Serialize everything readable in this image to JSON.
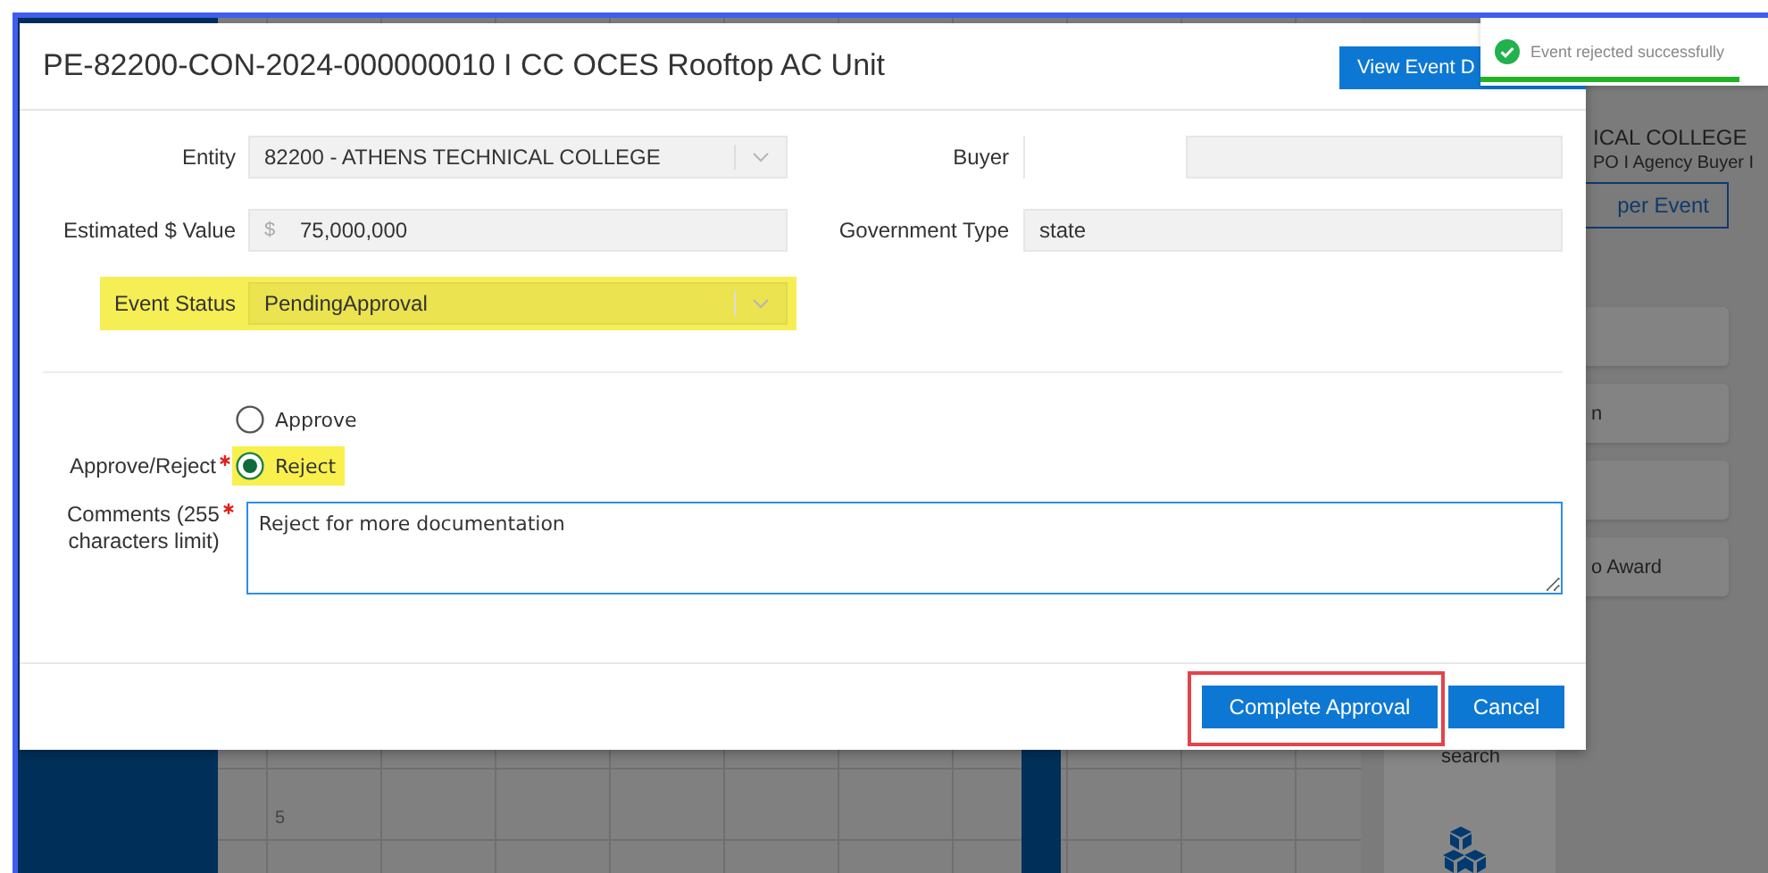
{
  "modal": {
    "title": "PE-82200-CON-2024-000000010 I CC OCES Rooftop AC Unit",
    "header_button": "View Event D",
    "rows": [
      {
        "left": {
          "label": "Entity",
          "kind": "dropdown",
          "value": "82200 - ATHENS TECHNICAL COLLEGE",
          "highlighted": false
        },
        "right": {
          "label": "Buyer",
          "kind": "split"
        }
      },
      {
        "left": {
          "label": "Estimated $ Value",
          "kind": "currency",
          "prefix": "$",
          "value": "75,000,000",
          "highlighted": false
        },
        "right": {
          "label": "Government Type",
          "kind": "text",
          "value": "state"
        }
      },
      {
        "left": {
          "label": "Event Status",
          "kind": "dropdown",
          "value": "PendingApproval",
          "highlighted": true
        }
      }
    ],
    "decision": {
      "label": "Approve/Reject",
      "required": true,
      "options": [
        {
          "label": "Approve",
          "selected": false,
          "highlighted": false
        },
        {
          "label": "Reject",
          "selected": true,
          "highlighted": true
        }
      ]
    },
    "comments": {
      "label": "Comments (255 characters limit)",
      "required": true,
      "value": "Reject for more documentation"
    },
    "buttons": [
      {
        "label": "Complete Approval",
        "outlined": true
      },
      {
        "label": "Cancel",
        "outlined": false
      }
    ]
  },
  "toast": {
    "message": "Event rejected successfully",
    "level": 0.9
  },
  "background": {
    "heading": "ICAL COLLEGE",
    "subheading": "PO I Agency Buyer I",
    "outline_button": "per Event",
    "cards": [
      {
        "kind": "blank"
      },
      {
        "kind": "text",
        "text": "n"
      },
      {
        "kind": "blank"
      },
      {
        "kind": "text",
        "text": "o Award"
      }
    ],
    "tile_label": "search",
    "axis_label": "5"
  }
}
